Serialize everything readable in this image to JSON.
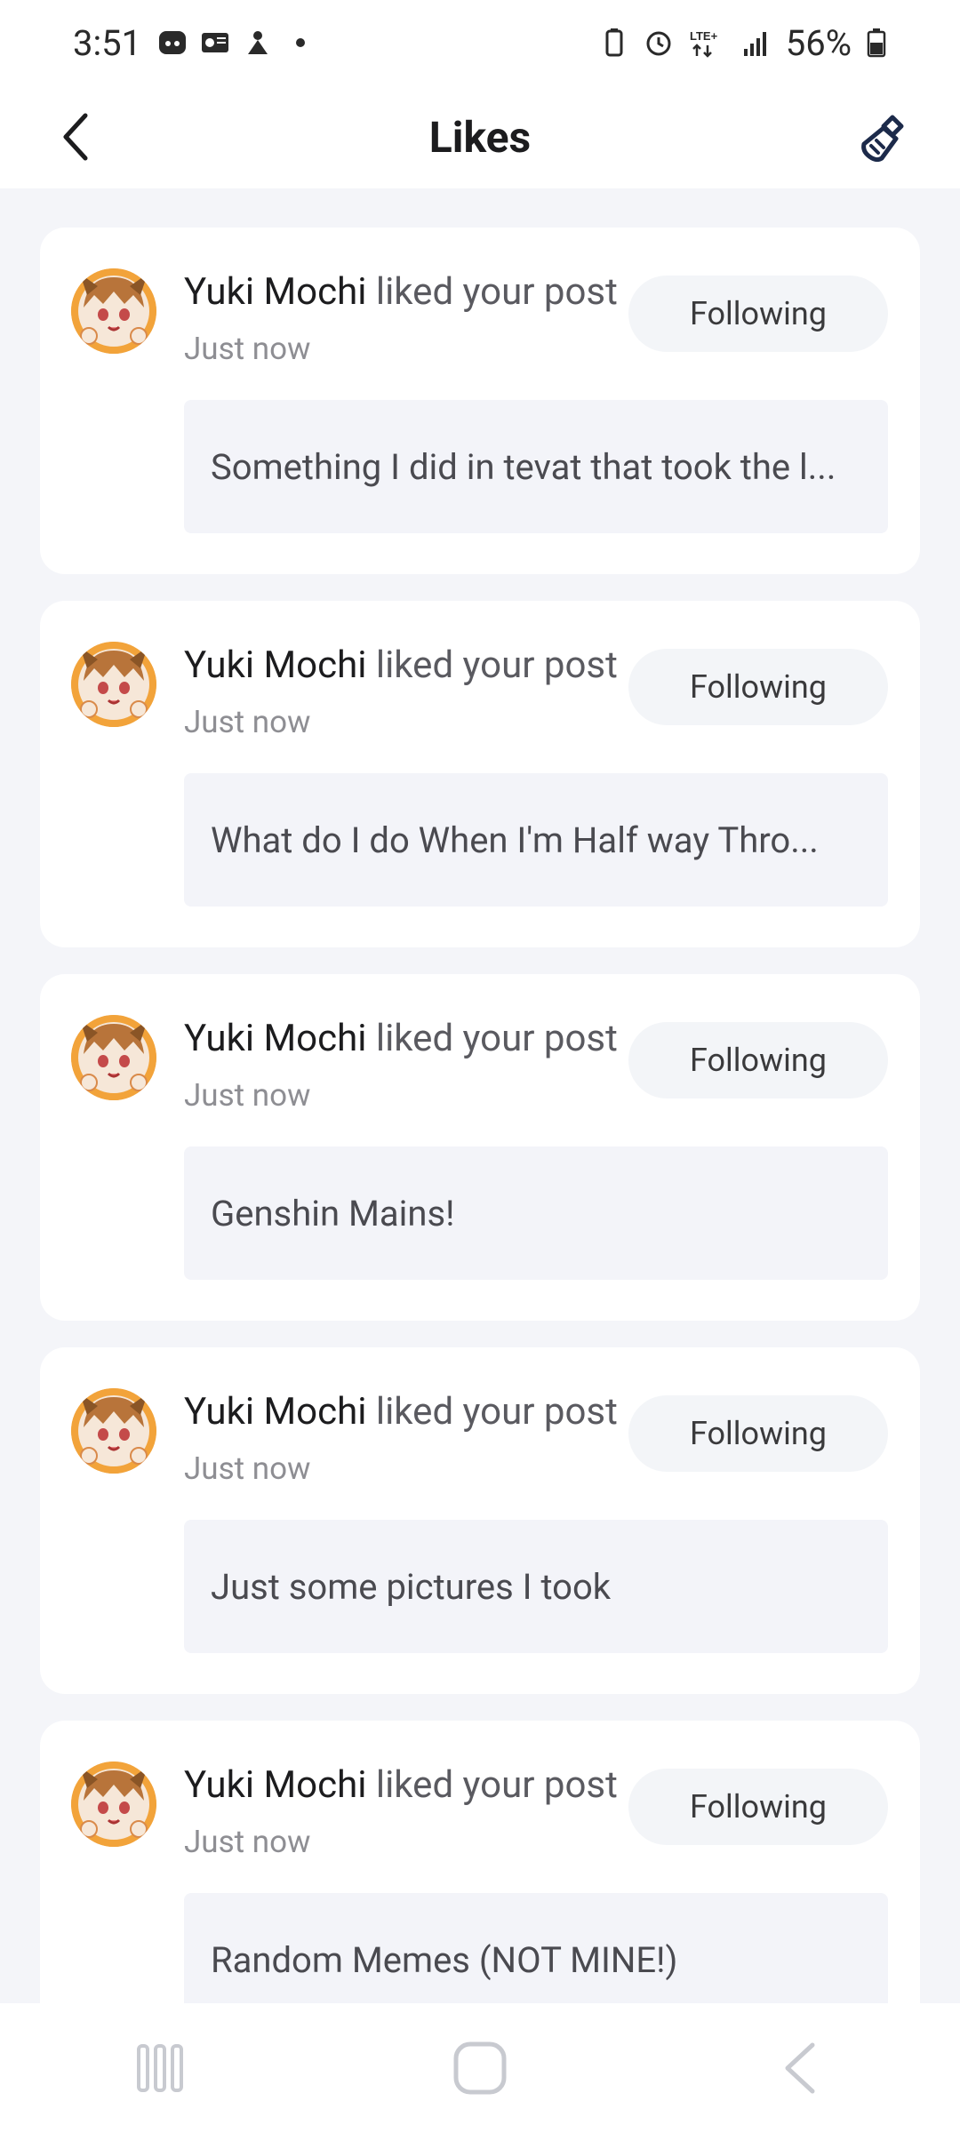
{
  "status_bar": {
    "time": "3:51",
    "battery_percent": "56%",
    "network": "LTE+"
  },
  "header": {
    "title": "Likes",
    "back_icon": "chevron-left-icon",
    "action_icon": "broom-icon"
  },
  "notifications": [
    {
      "user": "Yuki Mochi",
      "action": " liked your post",
      "time": "Just now",
      "button": "Following",
      "post": "Something I did in tevat that took the l..."
    },
    {
      "user": "Yuki Mochi",
      "action": " liked your post",
      "time": "Just now",
      "button": "Following",
      "post": "What do I do When I'm Half way Thro..."
    },
    {
      "user": "Yuki Mochi",
      "action": " liked your post",
      "time": "Just now",
      "button": "Following",
      "post": "Genshin Mains!"
    },
    {
      "user": "Yuki Mochi",
      "action": " liked your post",
      "time": "Just now",
      "button": "Following",
      "post": "Just some pictures I took"
    },
    {
      "user": "Yuki Mochi",
      "action": " liked your post",
      "time": "Just now",
      "button": "Following",
      "post": "Random Memes (NOT MINE!)"
    }
  ],
  "colors": {
    "background": "#f4f5f9",
    "card": "#ffffff",
    "avatar_ring": "#f2a33a"
  }
}
